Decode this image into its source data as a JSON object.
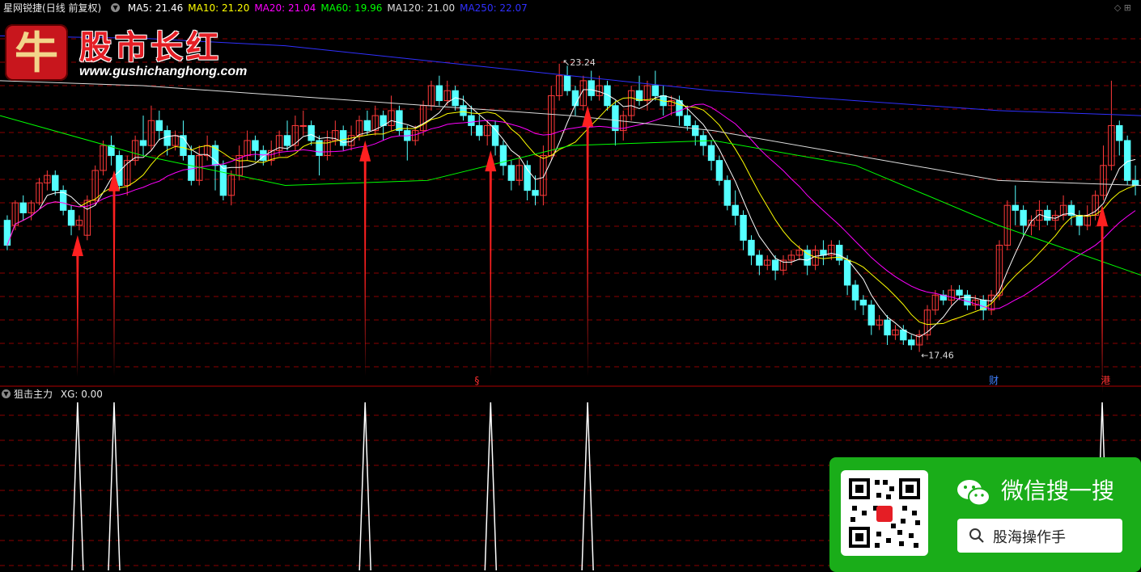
{
  "header": {
    "security_name": "星网锐捷",
    "period_label": "(日线 前复权)",
    "indicators": [
      {
        "label": "MA5: 21.46",
        "color": "#ffffff"
      },
      {
        "label": "MA10: 21.20",
        "color": "#ffff00"
      },
      {
        "label": "MA20: 21.04",
        "color": "#ff00ff"
      },
      {
        "label": "MA60: 19.96",
        "color": "#00ff00"
      },
      {
        "label": "MA120: 21.00",
        "color": "#dddddd"
      },
      {
        "label": "MA250: 22.07",
        "color": "#3030ff"
      }
    ],
    "right_controls": "◇ ⊞"
  },
  "logo": {
    "badge_char": "牛",
    "name": "股市长红",
    "url": "www.gushichanghong.com"
  },
  "chart_annotations": {
    "high_label": "23.24",
    "low_label": "17.46"
  },
  "event_markers": [
    {
      "label": "§",
      "color": "#ff3030"
    },
    {
      "label": "财",
      "color": "#4080ff"
    },
    {
      "label": "港",
      "color": "#ff3030"
    }
  ],
  "sub_panel": {
    "title": "狙击主力",
    "value_label": "XG: 0.00"
  },
  "wechat_card": {
    "title": "微信搜一搜",
    "search_text": "股海操作手"
  },
  "colors": {
    "up": "#ff3a3a",
    "down": "#54ffff",
    "grid": "#8b0000",
    "arrow": "#ff2020",
    "signal": "#ffffff"
  },
  "chart_data": {
    "type": "candlestick",
    "price_ylim": [
      17.0,
      24.0
    ],
    "signal_ylim": [
      0,
      1
    ],
    "candles": [
      [
        20.1,
        19.6,
        20.2,
        19.5
      ],
      [
        20.0,
        20.45,
        20.5,
        19.9
      ],
      [
        20.45,
        20.25,
        20.6,
        20.1
      ],
      [
        20.25,
        20.45,
        20.5,
        20.1
      ],
      [
        20.45,
        20.85,
        20.95,
        20.4
      ],
      [
        20.85,
        21.0,
        21.1,
        20.7
      ],
      [
        21.0,
        20.7,
        21.1,
        20.6
      ],
      [
        20.7,
        20.3,
        20.8,
        20.2
      ],
      [
        20.3,
        20.0,
        20.4,
        19.8
      ],
      [
        20.0,
        20.1,
        20.2,
        19.9
      ],
      [
        19.8,
        20.5,
        20.6,
        19.7
      ],
      [
        20.5,
        21.1,
        21.2,
        20.4
      ],
      [
        21.1,
        21.6,
        21.7,
        21.0
      ],
      [
        21.6,
        21.4,
        21.8,
        21.2
      ],
      [
        21.4,
        20.8,
        21.5,
        20.7
      ],
      [
        20.8,
        21.3,
        21.4,
        20.6
      ],
      [
        21.3,
        21.7,
        21.8,
        21.2
      ],
      [
        21.7,
        21.6,
        22.2,
        21.4
      ],
      [
        21.6,
        22.1,
        22.4,
        21.5
      ],
      [
        22.1,
        21.9,
        22.3,
        21.7
      ],
      [
        21.9,
        21.6,
        22.0,
        21.4
      ],
      [
        21.6,
        21.8,
        21.9,
        21.5
      ],
      [
        21.8,
        21.4,
        22.1,
        21.3
      ],
      [
        21.4,
        20.9,
        21.6,
        20.8
      ],
      [
        20.9,
        21.4,
        21.6,
        20.8
      ],
      [
        21.4,
        21.6,
        21.8,
        21.3
      ],
      [
        21.6,
        21.2,
        21.7,
        20.7
      ],
      [
        21.2,
        20.6,
        21.3,
        20.5
      ],
      [
        20.6,
        21.0,
        21.1,
        20.4
      ],
      [
        21.0,
        21.4,
        21.6,
        20.9
      ],
      [
        21.4,
        21.7,
        21.9,
        21.3
      ],
      [
        21.7,
        21.5,
        21.8,
        21.3
      ],
      [
        21.5,
        21.3,
        21.6,
        21.2
      ],
      [
        21.3,
        21.5,
        21.7,
        21.2
      ],
      [
        21.5,
        21.8,
        21.9,
        21.4
      ],
      [
        21.8,
        21.6,
        22.1,
        21.5
      ],
      [
        21.6,
        22.0,
        22.2,
        21.5
      ],
      [
        22.0,
        22.0,
        22.3,
        21.8
      ],
      [
        22.0,
        21.7,
        22.1,
        21.6
      ],
      [
        21.7,
        21.4,
        21.8,
        21.0
      ],
      [
        21.4,
        21.7,
        21.9,
        21.3
      ],
      [
        21.7,
        21.9,
        22.1,
        21.6
      ],
      [
        21.9,
        21.6,
        22.0,
        21.5
      ],
      [
        21.6,
        21.8,
        22.0,
        21.5
      ],
      [
        21.8,
        22.1,
        22.2,
        21.7
      ],
      [
        22.1,
        21.9,
        22.3,
        21.8
      ],
      [
        21.9,
        22.2,
        22.4,
        21.8
      ],
      [
        22.2,
        22.0,
        22.3,
        21.7
      ],
      [
        22.0,
        22.3,
        22.6,
        21.9
      ],
      [
        22.3,
        21.9,
        22.4,
        21.8
      ],
      [
        21.9,
        21.7,
        22.0,
        21.3
      ],
      [
        21.7,
        21.9,
        22.0,
        21.6
      ],
      [
        21.9,
        22.4,
        22.5,
        21.8
      ],
      [
        22.4,
        22.8,
        22.9,
        22.3
      ],
      [
        22.8,
        22.5,
        23.0,
        22.4
      ],
      [
        22.5,
        22.7,
        22.9,
        22.4
      ],
      [
        22.7,
        22.4,
        22.8,
        22.3
      ],
      [
        22.4,
        22.2,
        22.6,
        22.1
      ],
      [
        22.2,
        22.0,
        22.4,
        21.8
      ],
      [
        22.0,
        21.8,
        22.2,
        21.7
      ],
      [
        21.8,
        22.0,
        22.1,
        21.6
      ],
      [
        22.0,
        21.6,
        22.1,
        21.4
      ],
      [
        21.6,
        21.2,
        21.7,
        21.0
      ],
      [
        21.2,
        20.9,
        21.3,
        20.7
      ],
      [
        20.9,
        21.2,
        21.4,
        20.8
      ],
      [
        21.2,
        20.7,
        21.3,
        20.5
      ],
      [
        20.7,
        20.6,
        21.0,
        20.4
      ],
      [
        20.6,
        21.4,
        21.6,
        20.4
      ],
      [
        21.4,
        22.6,
        22.8,
        21.3
      ],
      [
        22.6,
        23.0,
        23.24,
        22.5
      ],
      [
        23.0,
        22.7,
        23.2,
        22.6
      ],
      [
        22.7,
        22.4,
        22.8,
        22.2
      ],
      [
        22.4,
        22.9,
        23.0,
        22.3
      ],
      [
        22.9,
        22.6,
        23.1,
        22.5
      ],
      [
        22.6,
        22.8,
        23.0,
        22.5
      ],
      [
        22.8,
        22.4,
        22.9,
        22.3
      ],
      [
        22.4,
        21.9,
        22.5,
        21.6
      ],
      [
        21.9,
        22.2,
        22.3,
        21.7
      ],
      [
        22.2,
        22.7,
        22.8,
        22.1
      ],
      [
        22.7,
        22.5,
        23.0,
        22.4
      ],
      [
        22.5,
        22.8,
        22.9,
        22.3
      ],
      [
        22.8,
        22.6,
        23.1,
        22.5
      ],
      [
        22.6,
        22.4,
        22.8,
        22.2
      ],
      [
        22.4,
        22.5,
        22.6,
        22.2
      ],
      [
        22.5,
        22.2,
        22.6,
        22.0
      ],
      [
        22.2,
        22.0,
        22.4,
        21.9
      ],
      [
        22.0,
        21.8,
        22.1,
        21.6
      ],
      [
        21.8,
        21.6,
        21.9,
        21.4
      ],
      [
        21.6,
        21.3,
        21.7,
        21.1
      ],
      [
        21.3,
        20.9,
        21.4,
        20.8
      ],
      [
        20.9,
        20.4,
        21.0,
        20.3
      ],
      [
        20.4,
        20.2,
        20.7,
        20.0
      ],
      [
        20.2,
        19.7,
        20.3,
        19.5
      ],
      [
        19.7,
        19.4,
        19.8,
        19.2
      ],
      [
        19.4,
        19.2,
        19.5,
        19.0
      ],
      [
        19.2,
        19.3,
        19.4,
        19.1
      ],
      [
        19.3,
        19.1,
        19.4,
        18.9
      ],
      [
        19.1,
        19.3,
        19.4,
        19.0
      ],
      [
        19.3,
        19.4,
        19.5,
        19.2
      ],
      [
        19.4,
        19.5,
        19.6,
        19.3
      ],
      [
        19.5,
        19.2,
        19.6,
        19.0
      ],
      [
        19.2,
        19.5,
        19.6,
        19.1
      ],
      [
        19.5,
        19.4,
        19.7,
        19.2
      ],
      [
        19.4,
        19.6,
        19.7,
        19.3
      ],
      [
        19.6,
        19.3,
        19.7,
        19.2
      ],
      [
        19.3,
        18.8,
        19.4,
        18.6
      ],
      [
        18.8,
        18.5,
        18.9,
        18.3
      ],
      [
        18.5,
        18.4,
        18.6,
        18.2
      ],
      [
        18.4,
        18.0,
        18.5,
        17.8
      ],
      [
        18.0,
        18.1,
        18.2,
        17.9
      ],
      [
        18.1,
        17.8,
        18.2,
        17.6
      ],
      [
        17.8,
        17.9,
        18.0,
        17.7
      ],
      [
        17.9,
        17.7,
        18.0,
        17.6
      ],
      [
        17.7,
        17.6,
        17.8,
        17.5
      ],
      [
        17.6,
        17.8,
        17.9,
        17.46
      ],
      [
        17.8,
        18.3,
        18.4,
        17.7
      ],
      [
        18.3,
        18.6,
        18.7,
        18.2
      ],
      [
        18.6,
        18.5,
        18.7,
        18.4
      ],
      [
        18.5,
        18.7,
        18.8,
        18.4
      ],
      [
        18.7,
        18.6,
        18.8,
        18.5
      ],
      [
        18.6,
        18.4,
        18.7,
        18.3
      ],
      [
        18.4,
        18.5,
        18.6,
        18.3
      ],
      [
        18.5,
        18.3,
        18.6,
        18.1
      ],
      [
        18.3,
        18.6,
        18.7,
        18.2
      ],
      [
        18.6,
        19.6,
        19.7,
        18.5
      ],
      [
        19.6,
        20.4,
        20.5,
        19.5
      ],
      [
        20.4,
        20.3,
        20.8,
        20.0
      ],
      [
        20.3,
        20.0,
        20.4,
        19.8
      ],
      [
        20.0,
        20.1,
        20.2,
        19.8
      ],
      [
        20.1,
        20.3,
        20.5,
        19.9
      ],
      [
        20.3,
        20.1,
        20.4,
        20.0
      ],
      [
        20.1,
        20.2,
        20.3,
        19.9
      ],
      [
        20.2,
        20.4,
        20.6,
        20.1
      ],
      [
        20.4,
        20.2,
        20.5,
        20.0
      ],
      [
        20.2,
        20.0,
        20.3,
        19.8
      ],
      [
        20.0,
        20.2,
        20.4,
        19.9
      ],
      [
        20.2,
        20.6,
        20.7,
        20.1
      ],
      [
        20.6,
        21.2,
        21.6,
        20.5
      ],
      [
        21.2,
        22.0,
        22.9,
        21.1
      ],
      [
        22.0,
        21.7,
        22.1,
        21.4
      ],
      [
        21.7,
        20.9,
        21.8,
        20.8
      ],
      [
        20.9,
        20.8,
        21.2,
        20.6
      ]
    ],
    "signal_bar_indices": [
      13,
      23,
      63,
      93,
      110,
      252
    ],
    "signal_positions": [
      0.068,
      0.1,
      0.32,
      0.43,
      0.515,
      0.966
    ],
    "ma_lines": [
      {
        "name": "MA5",
        "color": "#ffffff"
      },
      {
        "name": "MA10",
        "color": "#ffff00"
      },
      {
        "name": "MA20",
        "color": "#ff00ff"
      },
      {
        "name": "MA60",
        "color": "#00ff00"
      },
      {
        "name": "MA120",
        "color": "#dddddd"
      },
      {
        "name": "MA250",
        "color": "#3030ff"
      }
    ],
    "ma250_path_values": [
      23.8,
      23.75,
      23.6,
      23.3,
      23.0,
      22.7,
      22.5,
      22.3,
      22.2
    ],
    "ma120_path_values": [
      22.9,
      22.8,
      22.6,
      22.4,
      22.2,
      21.9,
      21.4,
      20.9,
      20.8
    ],
    "ma60_path_values": [
      22.2,
      21.4,
      20.8,
      20.9,
      21.6,
      21.7,
      21.2,
      20.0,
      19.0
    ]
  }
}
